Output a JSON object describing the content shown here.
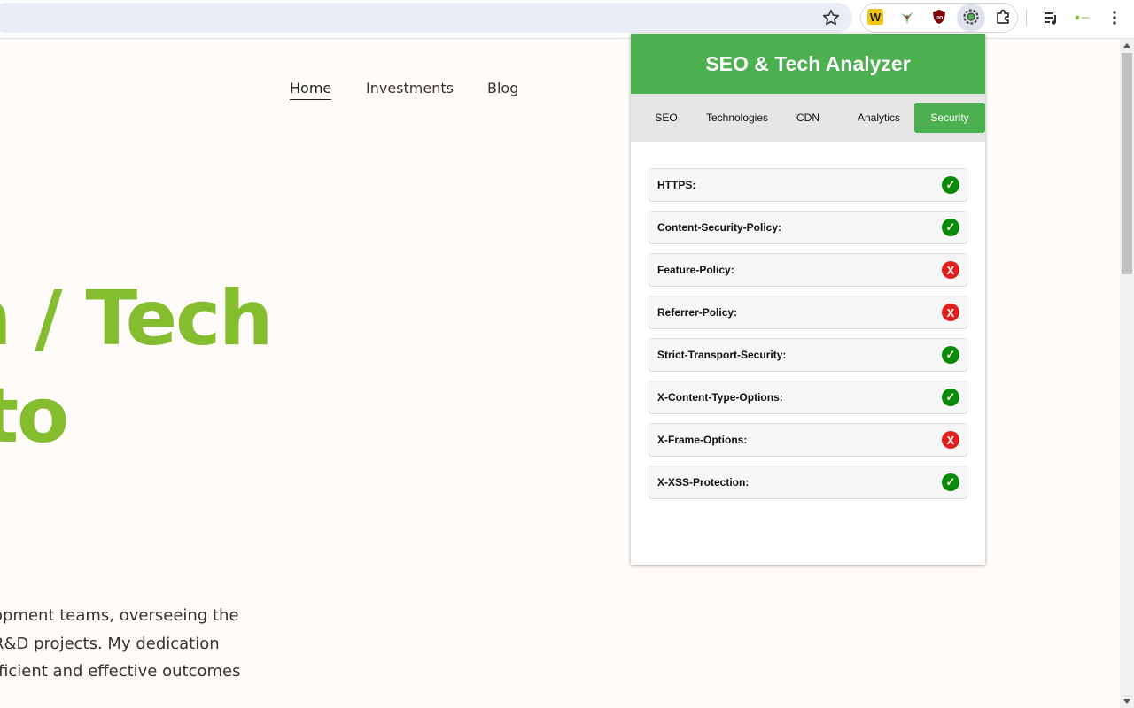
{
  "browser": {
    "star_icon": "star-icon",
    "extensions": [
      "wappalyzer-icon",
      "bird-icon",
      "ublock-icon",
      "gear-icon",
      "puzzle-icon"
    ],
    "toolbar_icons": [
      "media-queue-icon",
      "profile-icon",
      "more-icon"
    ]
  },
  "page": {
    "nav": [
      {
        "label": "Home",
        "active": true
      },
      {
        "label": "Investments",
        "active": false
      },
      {
        "label": "Blog",
        "active": false
      }
    ],
    "hero_line1": "n / Tech",
    "hero_line2": " to",
    "para_line1": "opment teams, overseeing the",
    "para_line2": "R&D projects. My dedication",
    "para_line3": "fficient and effective outcomes",
    "accent_color": "#84bd2e"
  },
  "popup": {
    "title": "SEO & Tech Analyzer",
    "header_color": "#4caf50",
    "tabs": [
      {
        "label": "SEO",
        "active": false
      },
      {
        "label": "Technologies",
        "active": false
      },
      {
        "label": "CDN",
        "active": false
      },
      {
        "label": "Analytics",
        "active": false
      },
      {
        "label": "Security",
        "active": true
      }
    ],
    "checks": [
      {
        "label": "HTTPS:",
        "ok": true,
        "symbol": "✓"
      },
      {
        "label": "Content-Security-Policy:",
        "ok": true,
        "symbol": "✓"
      },
      {
        "label": "Feature-Policy:",
        "ok": false,
        "symbol": "X"
      },
      {
        "label": "Referrer-Policy:",
        "ok": false,
        "symbol": "X"
      },
      {
        "label": "Strict-Transport-Security:",
        "ok": true,
        "symbol": "✓"
      },
      {
        "label": "X-Content-Type-Options:",
        "ok": true,
        "symbol": "✓"
      },
      {
        "label": "X-Frame-Options:",
        "ok": false,
        "symbol": "X"
      },
      {
        "label": "X-XSS-Protection:",
        "ok": true,
        "symbol": "✓"
      }
    ],
    "ok_color": "#0a8a0a",
    "fail_color": "#e0201c"
  }
}
